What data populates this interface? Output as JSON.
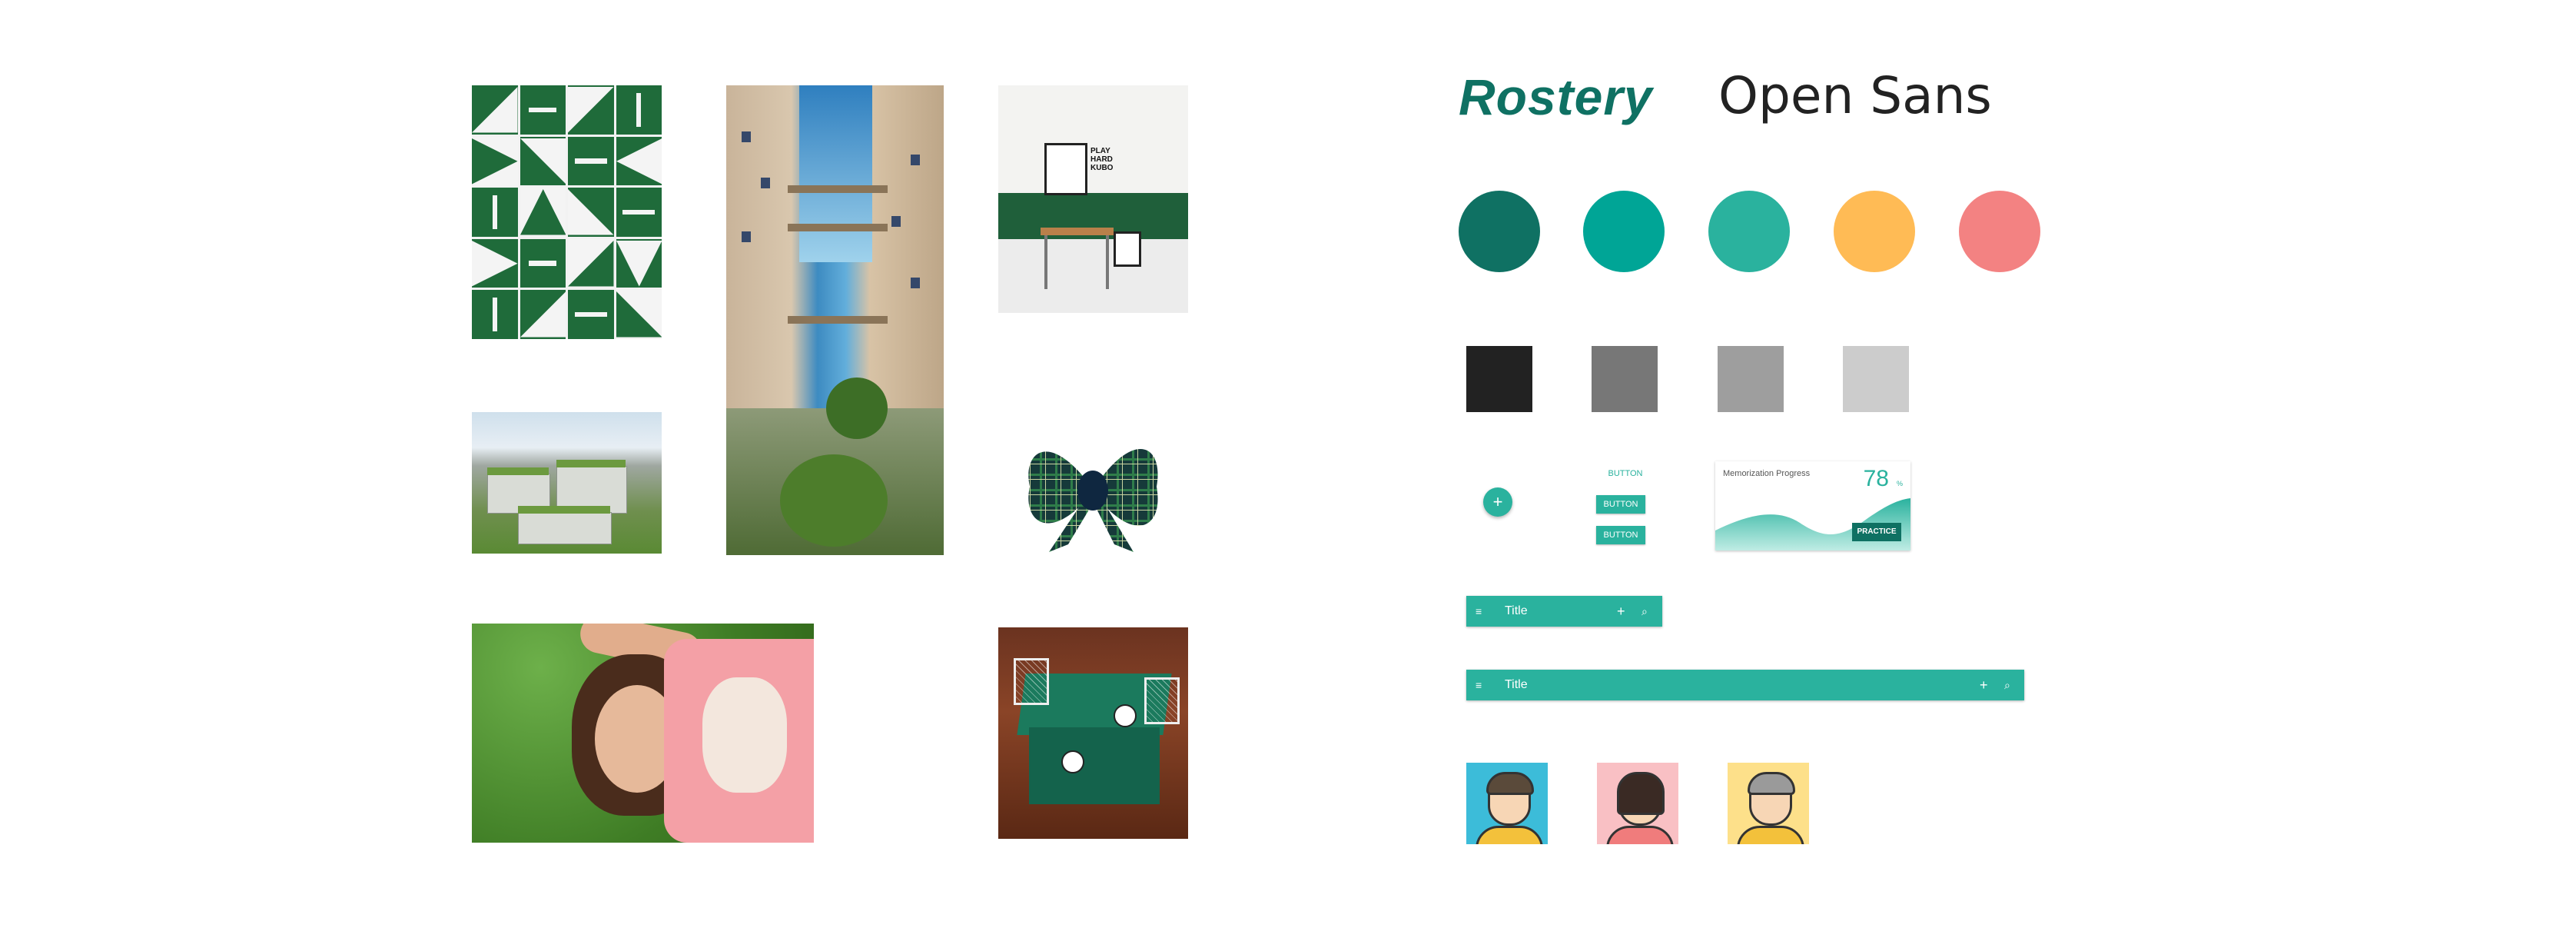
{
  "typography": {
    "brand_name": "Rostery",
    "font_name": "Open Sans"
  },
  "palette": {
    "primary_circles": [
      "#0f7163",
      "#00a596",
      "#2ab29e",
      "#ffbb55",
      "#f38282"
    ],
    "neutral_squares": [
      "#222222",
      "#777777",
      "#9e9e9e",
      "#cccccc"
    ]
  },
  "components": {
    "fab_icon": "+",
    "flat_button": "BUTTON",
    "raised_buttons": [
      "BUTTON",
      "BUTTON"
    ],
    "progress_card": {
      "label": "Memorization Progress",
      "value": "78",
      "unit": "%",
      "action": "PRACTICE"
    },
    "app_bar_small": {
      "menu_icon": "≡",
      "title": "Title",
      "add_icon": "+",
      "search_icon": "⌕"
    },
    "app_bar_wide": {
      "menu_icon": "≡",
      "title": "Title",
      "add_icon": "+",
      "search_icon": "⌕"
    }
  },
  "avatars": [
    {
      "name": "avatar-man",
      "bg": "#3cbcd9",
      "shirt": "#f3c13b",
      "hair": "#5a4a3a"
    },
    {
      "name": "avatar-woman",
      "bg": "#f9c0c4",
      "shirt": "#f07c7c",
      "hair": "#3a2a24"
    },
    {
      "name": "avatar-older-man",
      "bg": "#fde08a",
      "shirt": "#f3c13b",
      "hair": "#9a9a9a"
    }
  ],
  "poster_text": "PLAY HARD KUBO",
  "moodboard_images": [
    "green-white-tile-pattern",
    "courtyard-buildings",
    "green-wall-room",
    "campus-aerial",
    "plaid-bow",
    "woman-on-grass",
    "soccer-box"
  ]
}
